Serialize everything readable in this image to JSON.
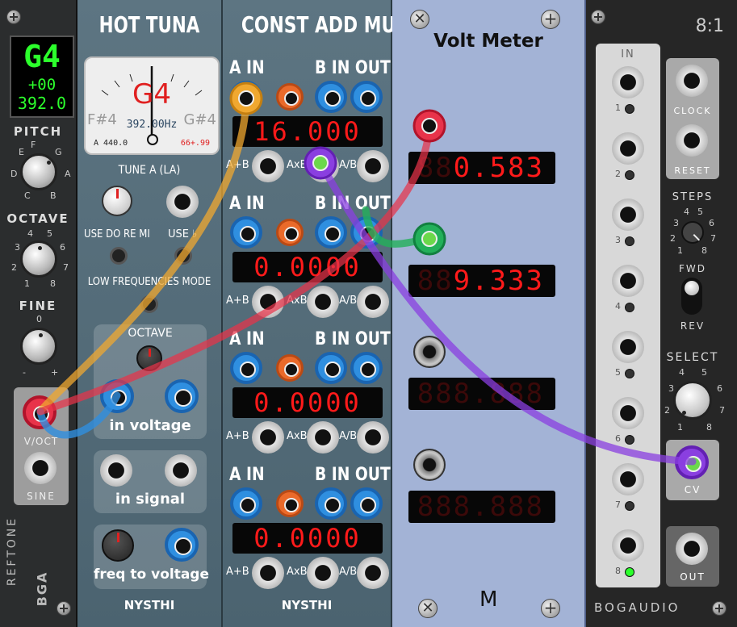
{
  "reftone": {
    "note": "G4",
    "cents": "+00",
    "freq": "392.0",
    "pitch_label": "PITCH",
    "octave_label": "OCTAVE",
    "fine_label": "FINE",
    "notes": [
      "C",
      "D",
      "E",
      "F",
      "G",
      "A",
      "B"
    ],
    "octave_ticks": [
      "1",
      "2",
      "3",
      "4",
      "5",
      "6",
      "7",
      "8"
    ],
    "fine_minus": "-",
    "fine_zero": "0",
    "fine_plus": "+",
    "voct_label": "V/OCT",
    "sine_label": "SINE",
    "brand": "REFTONE",
    "brand2": "BGA"
  },
  "hot_tuna": {
    "title": "HOT TUNA",
    "meter_note": "G4",
    "meter_freq": "392.00Hz",
    "meter_left": "F#4",
    "meter_right": "G#4",
    "meter_a": "A 440.0",
    "meter_cents": "66+.99",
    "tune_label": "TUNE A (LA)",
    "use_do_re_mi": "USE DO RE MI",
    "use_flat": "USE ♭",
    "low_freq_mode": "LOW FREQUENCIES MODE",
    "octave_label": "OCTAVE",
    "in_voltage": "in voltage",
    "in_signal": "in signal",
    "freq_to_voltage": "freq to voltage",
    "brand": "NYSTHI"
  },
  "const_add_mult": {
    "title": "CONST ADD MULT",
    "a_in": "A IN",
    "b_in": "B IN",
    "out": "OUT",
    "a_plus_b": "A+B",
    "a_x_b": "AxB",
    "a_div_b": "A/B",
    "displays": [
      "16.000",
      "0.0000",
      "0.0000",
      "0.0000"
    ],
    "brand": "NYSTHI"
  },
  "volt_meter": {
    "title": "Volt Meter",
    "readings": [
      "0.583",
      "9.333",
      "888.888",
      "888.888"
    ],
    "logo": "M"
  },
  "bogaudio": {
    "title": "8:1",
    "in_label": "IN",
    "channels": [
      "1",
      "2",
      "3",
      "4",
      "5",
      "6",
      "7",
      "8"
    ],
    "clock_label": "CLOCK",
    "reset_label": "RESET",
    "steps_label": "STEPS",
    "steps_ticks": [
      "1",
      "2",
      "3",
      "4",
      "5",
      "6",
      "7",
      "8"
    ],
    "fwd_label": "FWD",
    "rev_label": "REV",
    "select_label": "SELECT",
    "select_ticks": [
      "1",
      "2",
      "3",
      "4",
      "5",
      "6",
      "7",
      "8"
    ],
    "cv_label": "CV",
    "out_label": "OUT",
    "brand": "BOGAUDIO"
  },
  "colors": {
    "cable_yellow": "#f0a830",
    "cable_red": "#e8334a",
    "cable_blue": "#2f8fe0",
    "cable_purple": "#8a3fe0",
    "cable_green": "#23b05a",
    "led_green": "#2cff2c",
    "display_red": "#ff1a1a"
  }
}
